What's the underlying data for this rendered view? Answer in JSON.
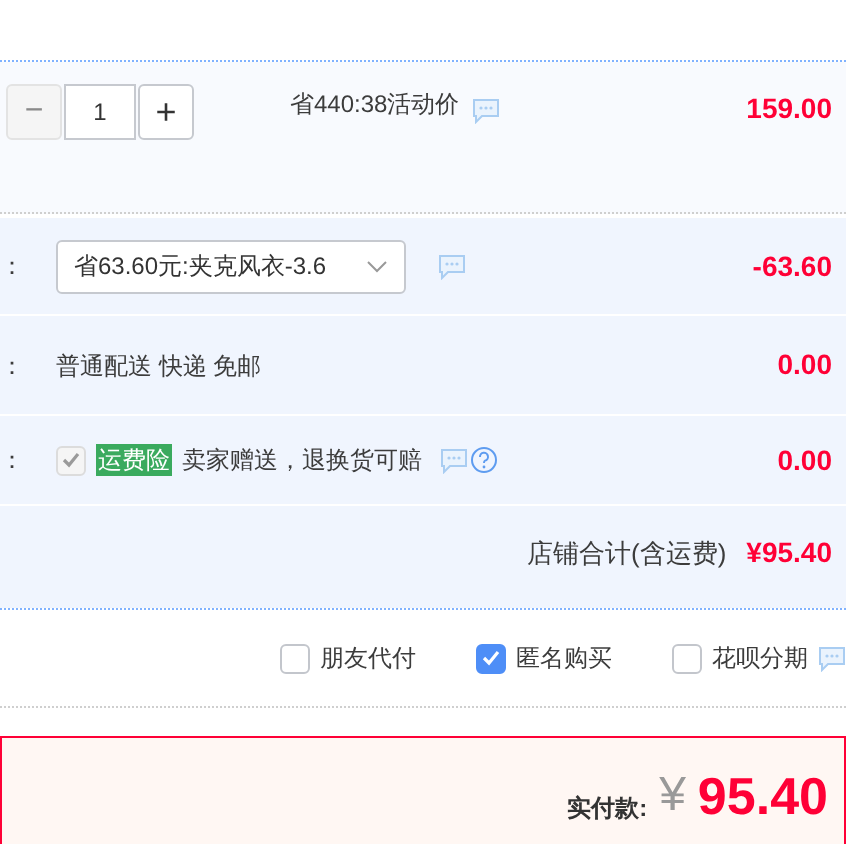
{
  "item": {
    "quantity": "1",
    "minus": "−",
    "plus": "+",
    "promo": "省440:38活动价",
    "price": "159.00",
    "minus_disabled": true
  },
  "rows": [
    {
      "kind": "select",
      "label": "：",
      "value": "省63.60元:夹克风衣-3.6",
      "amount": "-63.60"
    },
    {
      "kind": "text",
      "label": "：",
      "value": "普通配送 快递 免邮",
      "amount": "0.00"
    },
    {
      "kind": "insurance",
      "label": "：",
      "checked": true,
      "disabled": true,
      "tag": "运费险",
      "value": "卖家赠送，退换货可赔",
      "amount": "0.00"
    }
  ],
  "shop_total": {
    "label": "店铺合计(含运费)",
    "amount": "¥95.40"
  },
  "options": [
    {
      "label": "朋友代付",
      "checked": false
    },
    {
      "label": "匿名购买",
      "checked": true
    },
    {
      "label": "花呗分期",
      "checked": false
    }
  ],
  "payment": {
    "label": "实付款:",
    "currency": "¥",
    "amount": "95.40"
  }
}
